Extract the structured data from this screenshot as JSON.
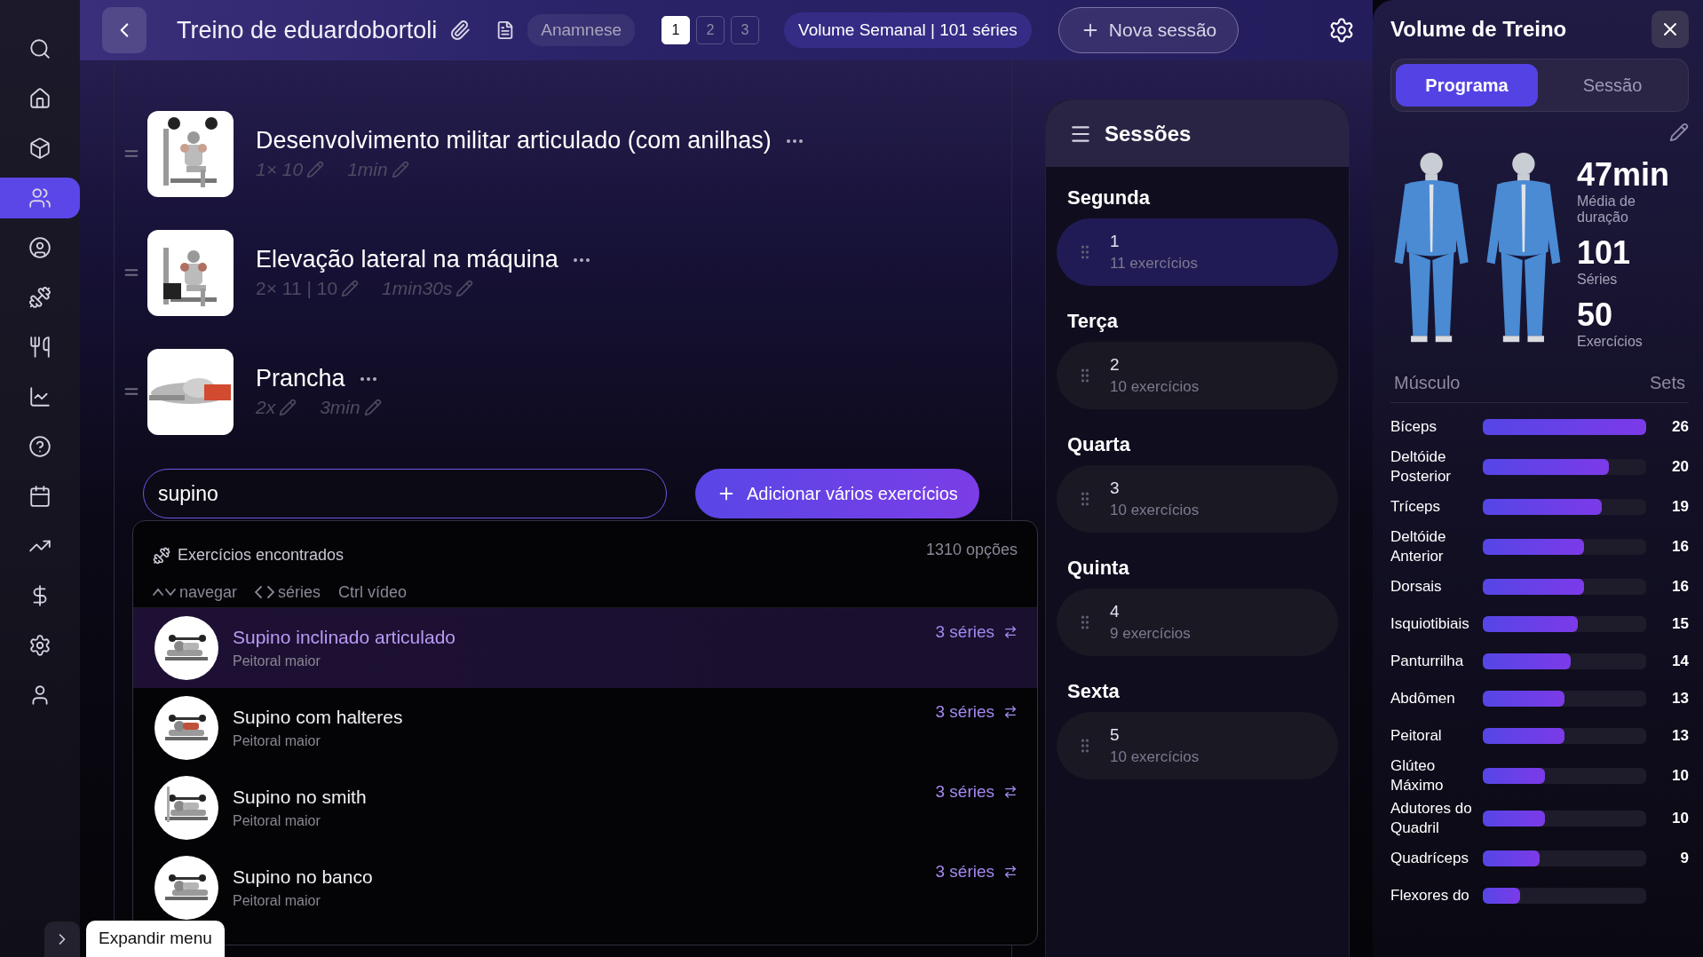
{
  "nav": [
    {
      "kind": "search",
      "selected": false
    },
    {
      "kind": "home",
      "selected": false
    },
    {
      "kind": "box",
      "selected": false
    },
    {
      "kind": "users",
      "selected": true
    },
    {
      "kind": "user-circle",
      "selected": false
    },
    {
      "kind": "dumbbell",
      "selected": false
    },
    {
      "kind": "utensils",
      "selected": false
    },
    {
      "kind": "chart",
      "selected": false
    },
    {
      "kind": "help",
      "selected": false
    },
    {
      "kind": "calendar",
      "selected": false
    },
    {
      "kind": "trending",
      "selected": false
    },
    {
      "kind": "dollar",
      "selected": false
    },
    {
      "kind": "settings",
      "selected": false
    },
    {
      "kind": "user",
      "selected": false
    }
  ],
  "expand_tooltip": "Expandir menu",
  "header": {
    "title": "Treino de eduardobortoli",
    "anamnese": "Anamnese",
    "pages": [
      {
        "label": "1",
        "selected": true
      },
      {
        "label": "2",
        "selected": false
      },
      {
        "label": "3",
        "selected": false
      }
    ],
    "volume_badge": "Volume Semanal | 101 séries",
    "new_session": "Nova sessão"
  },
  "exercises": [
    {
      "name": "Desenvolvimento militar articulado (com anilhas)",
      "sets": "1× 10",
      "sets_italic": true,
      "rest": "1min"
    },
    {
      "name": "Elevação lateral na máquina",
      "sets": "2× 11 | 10",
      "sets_italic": false,
      "rest": "1min30s"
    },
    {
      "name": "Prancha",
      "sets": "2x",
      "sets_italic": true,
      "rest": "3min"
    }
  ],
  "search": {
    "value": "supino"
  },
  "add_button": "Adicionar vários exercícios",
  "results": {
    "title": "Exercícios encontrados",
    "count": "1310 opções",
    "hints": [
      {
        "kind": "updown",
        "label": "navegar"
      },
      {
        "kind": "leftright",
        "label": "séries"
      },
      {
        "kind": "text",
        "label": "Ctrl vídeo"
      }
    ],
    "items": [
      {
        "name": "Supino inclinado articulado",
        "muscle": "Peitoral maior",
        "series": "3 séries",
        "selected": true
      },
      {
        "name": "Supino com halteres",
        "muscle": "Peitoral maior",
        "series": "3 séries",
        "selected": false
      },
      {
        "name": "Supino no smith",
        "muscle": "Peitoral maior",
        "series": "3 séries",
        "selected": false
      },
      {
        "name": "Supino no banco",
        "muscle": "Peitoral maior",
        "series": "3 séries",
        "selected": false
      }
    ]
  },
  "sessions": {
    "title": "Sessões",
    "days": [
      {
        "day": "Segunda",
        "number": "1",
        "count": "11 exercícios",
        "selected": true
      },
      {
        "day": "Terça",
        "number": "2",
        "count": "10 exercícios",
        "selected": false
      },
      {
        "day": "Quarta",
        "number": "3",
        "count": "10 exercícios",
        "selected": false
      },
      {
        "day": "Quinta",
        "number": "4",
        "count": "9 exercícios",
        "selected": false
      },
      {
        "day": "Sexta",
        "number": "5",
        "count": "10 exercícios",
        "selected": false
      }
    ]
  },
  "volume": {
    "title": "Volume de Treino",
    "tabs": [
      {
        "label": "Programa",
        "selected": true
      },
      {
        "label": "Sessão",
        "selected": false
      }
    ],
    "stats": [
      {
        "value": "47min",
        "label": "Média de duração"
      },
      {
        "value": "101",
        "label": "Séries"
      },
      {
        "value": "50",
        "label": "Exercícios"
      }
    ],
    "columns": [
      "Músculo",
      "Sets"
    ],
    "muscles": [
      {
        "name": "Bíceps",
        "sets": "26",
        "level": 1
      },
      {
        "name": "Deltóide Posterior",
        "sets": "20",
        "level": 0.77
      },
      {
        "name": "Tríceps",
        "sets": "19",
        "level": 0.73
      },
      {
        "name": "Deltóide Anterior",
        "sets": "16",
        "level": 0.62
      },
      {
        "name": "Dorsais",
        "sets": "16",
        "level": 0.62
      },
      {
        "name": "Isquiotibiais",
        "sets": "15",
        "level": 0.58
      },
      {
        "name": "Panturrilha",
        "sets": "14",
        "level": 0.54
      },
      {
        "name": "Abdômen",
        "sets": "13",
        "level": 0.5
      },
      {
        "name": "Peitoral",
        "sets": "13",
        "level": 0.5
      },
      {
        "name": "Glúteo Máximo",
        "sets": "10",
        "level": 0.38
      },
      {
        "name": "Adutores do Quadril",
        "sets": "10",
        "level": 0.38
      },
      {
        "name": "Quadríceps",
        "sets": "9",
        "level": 0.35
      },
      {
        "name": "Flexores do",
        "level": 0.23
      }
    ]
  }
}
